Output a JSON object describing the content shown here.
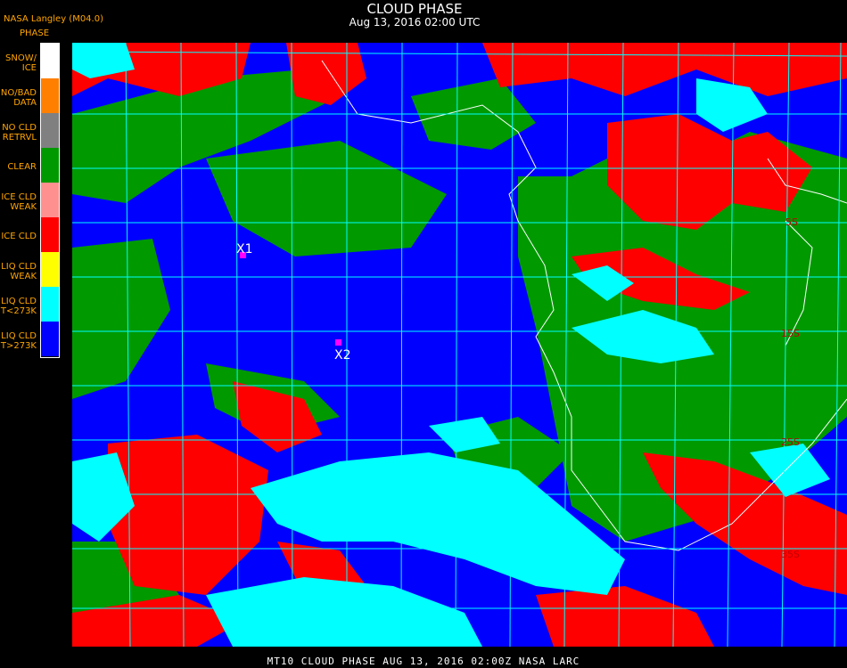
{
  "header": {
    "title": "CLOUD PHASE",
    "subtitle": "Aug 13, 2016 02:00 UTC",
    "credit": "NASA Langley (M04.0)"
  },
  "legend": {
    "title": "PHASE",
    "items": [
      {
        "label": "SNOW/\nICE",
        "color": "#ffffff"
      },
      {
        "label": "NO/BAD\nDATA",
        "color": "#ff7f00"
      },
      {
        "label": "NO CLD\nRETRVL",
        "color": "#808080"
      },
      {
        "label": "CLEAR",
        "color": "#009900"
      },
      {
        "label": "ICE CLD\nWEAK",
        "color": "#ff9090"
      },
      {
        "label": "ICE CLD",
        "color": "#ff0000"
      },
      {
        "label": "LIQ CLD\nWEAK",
        "color": "#ffff00"
      },
      {
        "label": "LIQ CLD\nT<273K",
        "color": "#00ffff"
      },
      {
        "label": "LIQ CLD\nT>273K",
        "color": "#0000ff"
      }
    ]
  },
  "markers": [
    {
      "label": "X1",
      "color": "#ff00ff"
    },
    {
      "label": "X2",
      "color": "#ff00ff"
    }
  ],
  "lat_labels": [
    "5S",
    "15S",
    "25S",
    "35S"
  ],
  "footer": "MT10  CLOUD PHASE   AUG 13, 2016 02:00Z   NASA LARC"
}
